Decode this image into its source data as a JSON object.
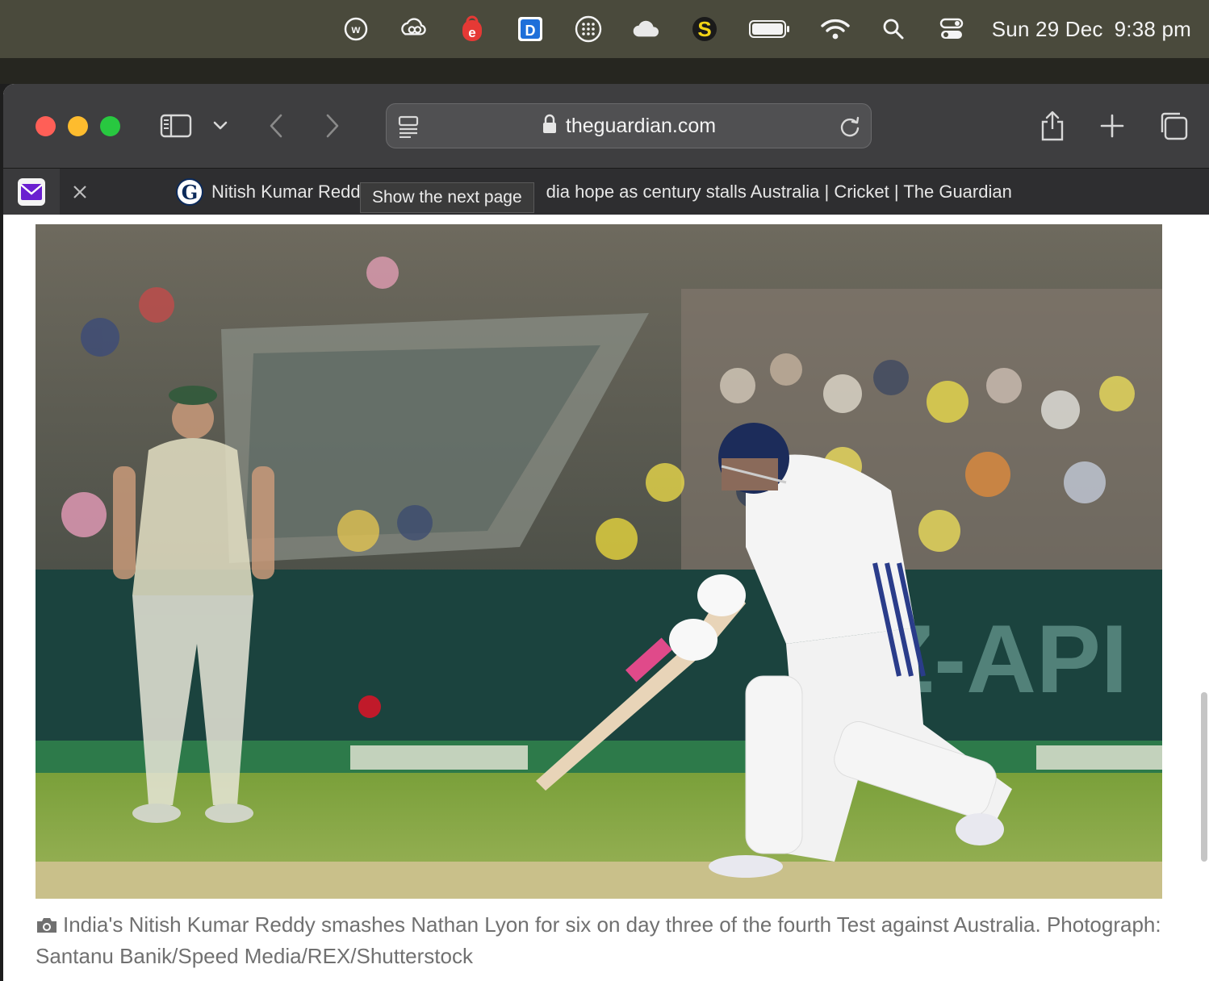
{
  "menubar": {
    "icons": [
      "w-circle-icon",
      "creative-cloud-icon",
      "e-red-icon",
      "d-app-icon",
      "grid-dots-icon",
      "cloud-icon",
      "s-yellow-icon",
      "battery-icon",
      "wifi-icon",
      "search-icon",
      "control-center-icon"
    ],
    "date": "Sun 29 Dec",
    "time": "9:38 pm"
  },
  "browser": {
    "url": "theguardian.com",
    "tab_title": "Nitish Kumar Reddy century gives India hope as century stalls Australia | Cricket | The Guardian",
    "tab_title_visible_start": "Nitish Kumar Redd",
    "tab_title_visible_end": "dia hope as century stalls Australia | Cricket | The Guardian",
    "favicon_letter": "G",
    "tooltip": "Show the next page"
  },
  "article": {
    "photo_alt": "India's Nitish Kumar Reddy smashes Nathan Lyon for six",
    "caption": "India's Nitish Kumar Reddy smashes Nathan Lyon for six on day three of the fourth Test against Australia. Photograph: Santanu Banik/Speed Media/REX/Shutterstock",
    "ad_board_text": "Z-API"
  },
  "colors": {
    "menubar": "#4a4a3c",
    "toolbar": "#3e3e40",
    "close": "#ff5f57",
    "minimize": "#febc2e",
    "maximize": "#28c840",
    "caption_text": "#707070"
  }
}
